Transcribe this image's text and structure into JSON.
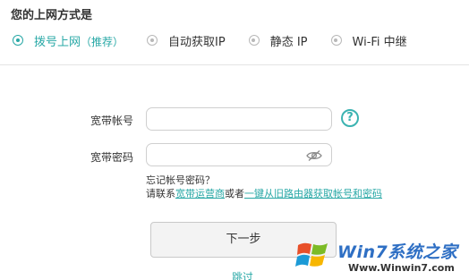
{
  "section": {
    "title": "您的上网方式是"
  },
  "modes": [
    {
      "label": "拨号上网",
      "hint": "（推荐）",
      "selected": true
    },
    {
      "label": "自动获取IP",
      "selected": false
    },
    {
      "label": "静态 IP",
      "selected": false
    },
    {
      "label": "Wi-Fi 中继",
      "selected": false
    }
  ],
  "form": {
    "account_label": "宽带帐号",
    "account_value": "",
    "password_label": "宽带密码",
    "password_value": "",
    "help_symbol": "?"
  },
  "notes": {
    "forgot": "忘记帐号密码？",
    "contact_prefix": "请联系",
    "isp_link": "宽带运营商",
    "or": "或者",
    "import_link": "一键从旧路由器获取帐号和密码"
  },
  "actions": {
    "next_label": "下一步",
    "skip_label": "跳过"
  },
  "watermark": {
    "title": "Win7系统之家",
    "url": "Www.Winwin7.com"
  },
  "colors": {
    "accent": "#28a8a6",
    "divider": "#e4e4e4",
    "button_bg": "#f3f3f3"
  }
}
